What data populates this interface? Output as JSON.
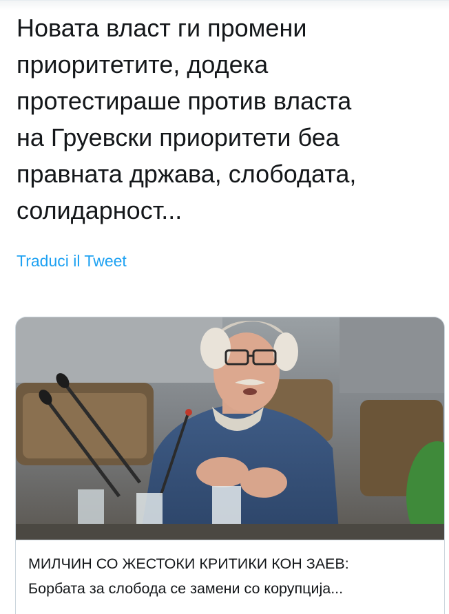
{
  "tweet": {
    "text": "Новата власт ги промени\nприоритетите, додека\nпротестираше против власта\nна Груевски приоритети беа\nправната држава, слободата,\nсолидарност...",
    "translate_label": "Traduci il Tweet"
  },
  "link_card": {
    "image_alt": "photo of an older man with white hair and glasses speaking into a microphone",
    "title": "МИЛЧИН СО ЖЕСТОКИ КРИТИКИ КОН ЗАЕВ:",
    "description": "Борбата за слобода се замени со корупција..."
  },
  "colors": {
    "text": "#14171a",
    "link": "#1da1f2",
    "border": "#ccd6dd"
  }
}
